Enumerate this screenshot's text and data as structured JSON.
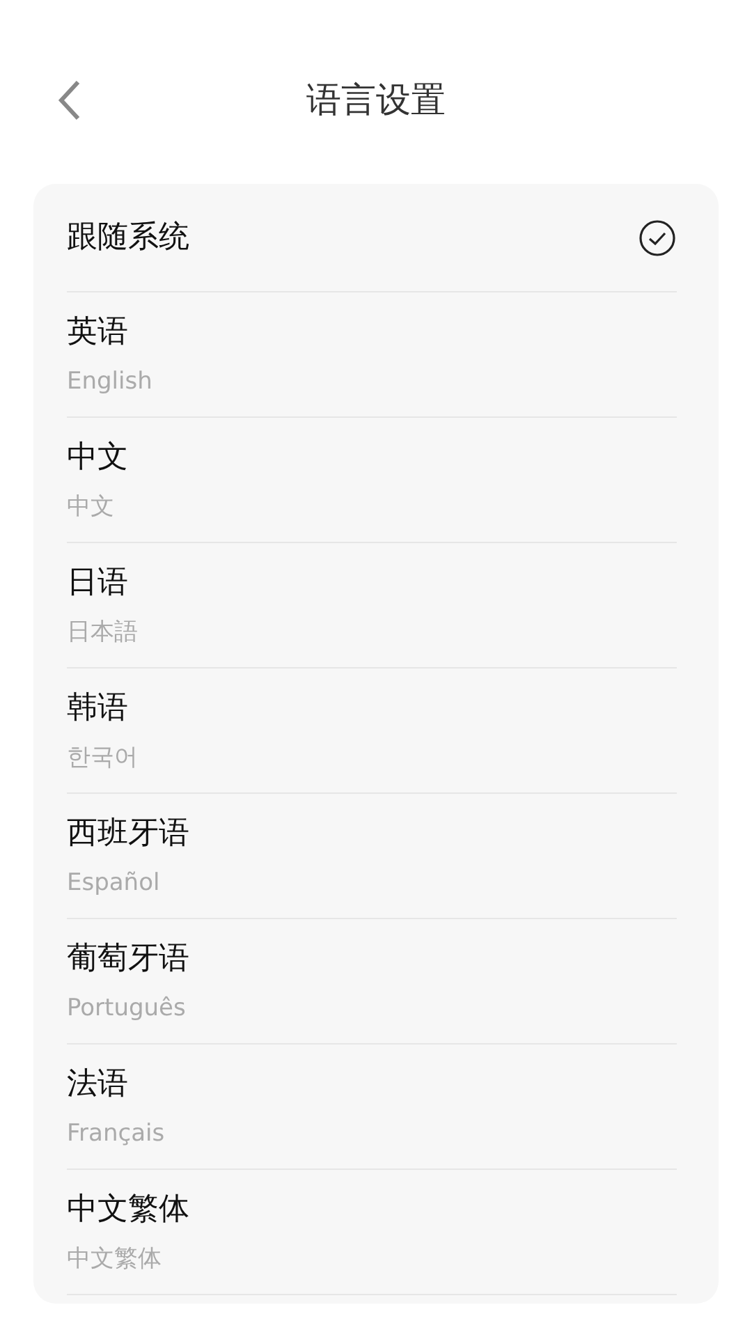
{
  "header": {
    "title": "语言设置"
  },
  "languages": [
    {
      "name": "跟随系统",
      "selected": true
    },
    {
      "name": "英语",
      "native": "English",
      "selected": false
    },
    {
      "name": "中文",
      "native": "中文",
      "selected": false
    },
    {
      "name": "日语",
      "native": "日本語",
      "selected": false
    },
    {
      "name": "韩语",
      "native": "한국어",
      "selected": false
    },
    {
      "name": "西班牙语",
      "native": "Español",
      "selected": false
    },
    {
      "name": "葡萄牙语",
      "native": "Português",
      "selected": false
    },
    {
      "name": "法语",
      "native": "Français",
      "selected": false
    },
    {
      "name": "中文繁体",
      "native": "中文繁体",
      "selected": false
    }
  ]
}
